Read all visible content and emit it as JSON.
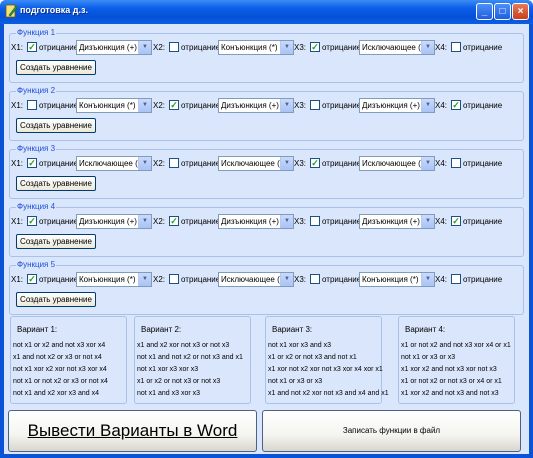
{
  "window": {
    "title": "подготовка д.з.",
    "minimize": "_",
    "maximize": "□",
    "close": "×"
  },
  "functions": [
    {
      "title": "Функция 1",
      "x": [
        {
          "label": "X1:",
          "negated": true,
          "negation_label": "отрицание",
          "operator": "Дизъюнкция (+)"
        },
        {
          "label": "X2:",
          "negated": false,
          "negation_label": "отрицание",
          "operator": "Конъюнкция  (*)"
        },
        {
          "label": "X3:",
          "negated": true,
          "negation_label": "отрицание",
          "operator": "Исключающее (ИЛ"
        },
        {
          "label": "X4:",
          "negated": false,
          "negation_label": "отрицание"
        }
      ],
      "button": "Создать уравнение"
    },
    {
      "title": "Функция 2",
      "x": [
        {
          "label": "X1:",
          "negated": false,
          "negation_label": "отрицание",
          "operator": "Конъюнкция  (*)"
        },
        {
          "label": "X2:",
          "negated": true,
          "negation_label": "отрицание",
          "operator": "Дизъюнкция (+)"
        },
        {
          "label": "X3:",
          "negated": false,
          "negation_label": "отрицание",
          "operator": "Дизъюнкция (+)"
        },
        {
          "label": "X4:",
          "negated": true,
          "negation_label": "отрицание"
        }
      ],
      "button": "Создать уравнение"
    },
    {
      "title": "Функция 3",
      "x": [
        {
          "label": "X1:",
          "negated": true,
          "negation_label": "отрицание",
          "operator": "Исключающее (ИЛ"
        },
        {
          "label": "X2:",
          "negated": false,
          "negation_label": "отрицание",
          "operator": "Исключающее (ИЛ"
        },
        {
          "label": "X3:",
          "negated": true,
          "negation_label": "отрицание",
          "operator": "Исключающее (ИЛ"
        },
        {
          "label": "X4:",
          "negated": false,
          "negation_label": "отрицание"
        }
      ],
      "button": "Создать уравнение"
    },
    {
      "title": "Функция 4",
      "x": [
        {
          "label": "X1:",
          "negated": true,
          "negation_label": "отрицание",
          "operator": "Дизъюнкция (+)"
        },
        {
          "label": "X2:",
          "negated": true,
          "negation_label": "отрицание",
          "operator": "Дизъюнкция (+)"
        },
        {
          "label": "X3:",
          "negated": false,
          "negation_label": "отрицание",
          "operator": "Дизъюнкция (+)"
        },
        {
          "label": "X4:",
          "negated": true,
          "negation_label": "отрицание"
        }
      ],
      "button": "Создать уравнение"
    },
    {
      "title": "Функция 5",
      "x": [
        {
          "label": "X1:",
          "negated": true,
          "negation_label": "отрицание",
          "operator": "Конъюнкция  (*)"
        },
        {
          "label": "X2:",
          "negated": false,
          "negation_label": "отрицание",
          "operator": "Исключающее (ИЛ"
        },
        {
          "label": "X3:",
          "negated": false,
          "negation_label": "отрицание",
          "operator": "Конъюнкция  (*)"
        },
        {
          "label": "X4:",
          "negated": false,
          "negation_label": "отрицание"
        }
      ],
      "button": "Создать уравнение"
    }
  ],
  "variants": [
    {
      "title": "Вариант 1:",
      "lines": [
        "not x1 or x2 and not x3 xor x4",
        "x1 and not x2 or x3 or not x4",
        "not x1 xor x2 xor not x3 xor x4",
        "not x1 or not x2 or x3 or not x4",
        "not x1 and x2 xor x3 and x4"
      ]
    },
    {
      "title": "Вариант 2:",
      "lines": [
        "x1 and x2 xor not x3 or not x3",
        "not x1 and not x2 or not x3 and x1",
        "not x1 xor x3 xor x3",
        "x1 or x2 or not x3 or not x3",
        "not x1 and x3 xor x3"
      ]
    },
    {
      "title": "Вариант 3:",
      "lines": [
        "not x1 xor x3 and x3",
        "x1 or x2 or not x3 and not x1",
        "x1 xor not x2 xor not x3 xor x4 xor x1",
        "not x1 or x3 or x3",
        "x1 and not x2 xor not x3 and x4 and x1"
      ]
    },
    {
      "title": "Вариант 4:",
      "lines": [
        "x1 or not x2 and not x3 xor x4 or x1",
        "not x1 or x3 or x3",
        "x1 xor x2 and not x3 xor not x3",
        "x1 or not x2 or not x3 or x4 or x1",
        "x1 xor x2 and not x3 and not x3"
      ]
    }
  ],
  "buttons": {
    "word": "Вывести Варианты в Word",
    "file": "Записать функции в файл"
  },
  "colors": {
    "titlebar": "#0a5ee8",
    "client": "#dae6fb",
    "group_title": "#1f4fd8",
    "check_mark": "#21a121"
  },
  "icons": {
    "app": "pencil-icon",
    "checkbox_checked": "check-icon",
    "combo_arrow": "chevron-down-icon"
  }
}
